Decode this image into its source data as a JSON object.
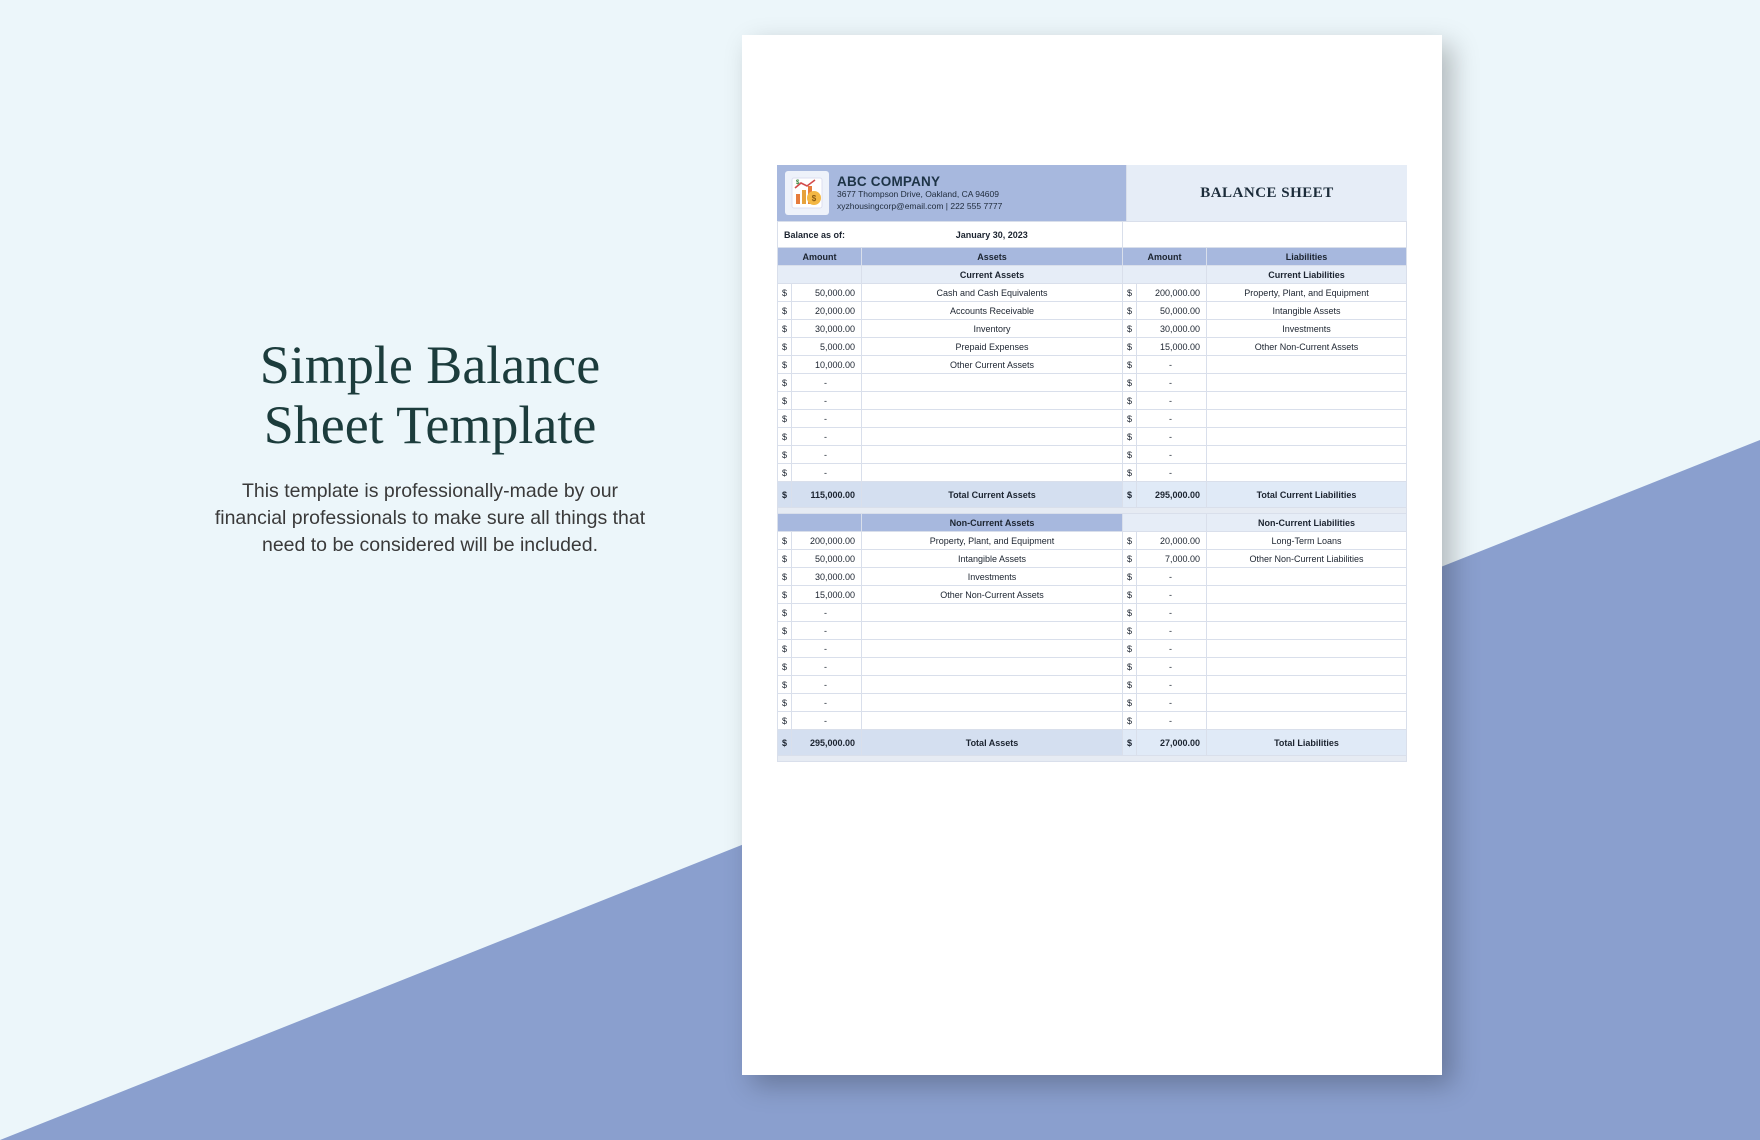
{
  "promo": {
    "title": "Simple Balance Sheet Template",
    "description": "This template is professionally-made by our financial professionals to make sure all things that need to be considered will be included."
  },
  "header": {
    "company_name": "ABC COMPANY",
    "address": "3677 Thompson Drive, Oakland, CA 94609",
    "contact": "xyzhousingcorp@email.com | 222 555 7777",
    "doc_title": "BALANCE SHEET",
    "icon": "finance-icon"
  },
  "balance_asof": {
    "label": "Balance as of:",
    "date": "January 30, 2023"
  },
  "cols": {
    "amount": "Amount",
    "assets": "Assets",
    "liabilities": "Liabilities"
  },
  "sections": {
    "ca_title": "Current Assets",
    "cl_title": "Current Liabilities",
    "nca_title": "Non-Current Assets",
    "ncl_title": "Non-Current Liabilities"
  },
  "current_assets": [
    {
      "amount": "50,000.00",
      "label": "Cash and Cash Equivalents"
    },
    {
      "amount": "20,000.00",
      "label": "Accounts Receivable"
    },
    {
      "amount": "30,000.00",
      "label": "Inventory"
    },
    {
      "amount": "5,000.00",
      "label": "Prepaid Expenses"
    },
    {
      "amount": "10,000.00",
      "label": "Other Current Assets"
    },
    {
      "amount": "-",
      "label": ""
    },
    {
      "amount": "-",
      "label": ""
    },
    {
      "amount": "-",
      "label": ""
    },
    {
      "amount": "-",
      "label": ""
    },
    {
      "amount": "-",
      "label": ""
    },
    {
      "amount": "-",
      "label": ""
    }
  ],
  "current_liabilities": [
    {
      "amount": "200,000.00",
      "label": "Property, Plant, and Equipment"
    },
    {
      "amount": "50,000.00",
      "label": "Intangible Assets"
    },
    {
      "amount": "30,000.00",
      "label": "Investments"
    },
    {
      "amount": "15,000.00",
      "label": "Other Non-Current Assets"
    },
    {
      "amount": "-",
      "label": ""
    },
    {
      "amount": "-",
      "label": ""
    },
    {
      "amount": "-",
      "label": ""
    },
    {
      "amount": "-",
      "label": ""
    },
    {
      "amount": "-",
      "label": ""
    },
    {
      "amount": "-",
      "label": ""
    },
    {
      "amount": "-",
      "label": ""
    }
  ],
  "totals1": {
    "ca_amount": "115,000.00",
    "ca_label": "Total Current Assets",
    "cl_amount": "295,000.00",
    "cl_label": "Total Current Liabilities"
  },
  "noncurrent_assets": [
    {
      "amount": "200,000.00",
      "label": "Property, Plant, and Equipment"
    },
    {
      "amount": "50,000.00",
      "label": "Intangible Assets"
    },
    {
      "amount": "30,000.00",
      "label": "Investments"
    },
    {
      "amount": "15,000.00",
      "label": "Other Non-Current Assets"
    },
    {
      "amount": "-",
      "label": ""
    },
    {
      "amount": "-",
      "label": ""
    },
    {
      "amount": "-",
      "label": ""
    },
    {
      "amount": "-",
      "label": ""
    },
    {
      "amount": "-",
      "label": ""
    },
    {
      "amount": "-",
      "label": ""
    },
    {
      "amount": "-",
      "label": ""
    }
  ],
  "noncurrent_liabilities": [
    {
      "amount": "20,000.00",
      "label": "Long-Term Loans"
    },
    {
      "amount": "7,000.00",
      "label": "Other Non-Current Liabilities"
    },
    {
      "amount": "-",
      "label": ""
    },
    {
      "amount": "-",
      "label": ""
    },
    {
      "amount": "-",
      "label": ""
    },
    {
      "amount": "-",
      "label": ""
    },
    {
      "amount": "-",
      "label": ""
    },
    {
      "amount": "-",
      "label": ""
    },
    {
      "amount": "-",
      "label": ""
    },
    {
      "amount": "-",
      "label": ""
    },
    {
      "amount": "-",
      "label": ""
    }
  ],
  "totals2": {
    "ta_amount": "295,000.00",
    "ta_label": "Total Assets",
    "tl_amount": "27,000.00",
    "tl_label": "Total Liabilities"
  },
  "currency": "$",
  "colors": {
    "accent": "#8a9fce",
    "header_bg": "#a7b8de",
    "light_bg": "#ecf6fa"
  }
}
